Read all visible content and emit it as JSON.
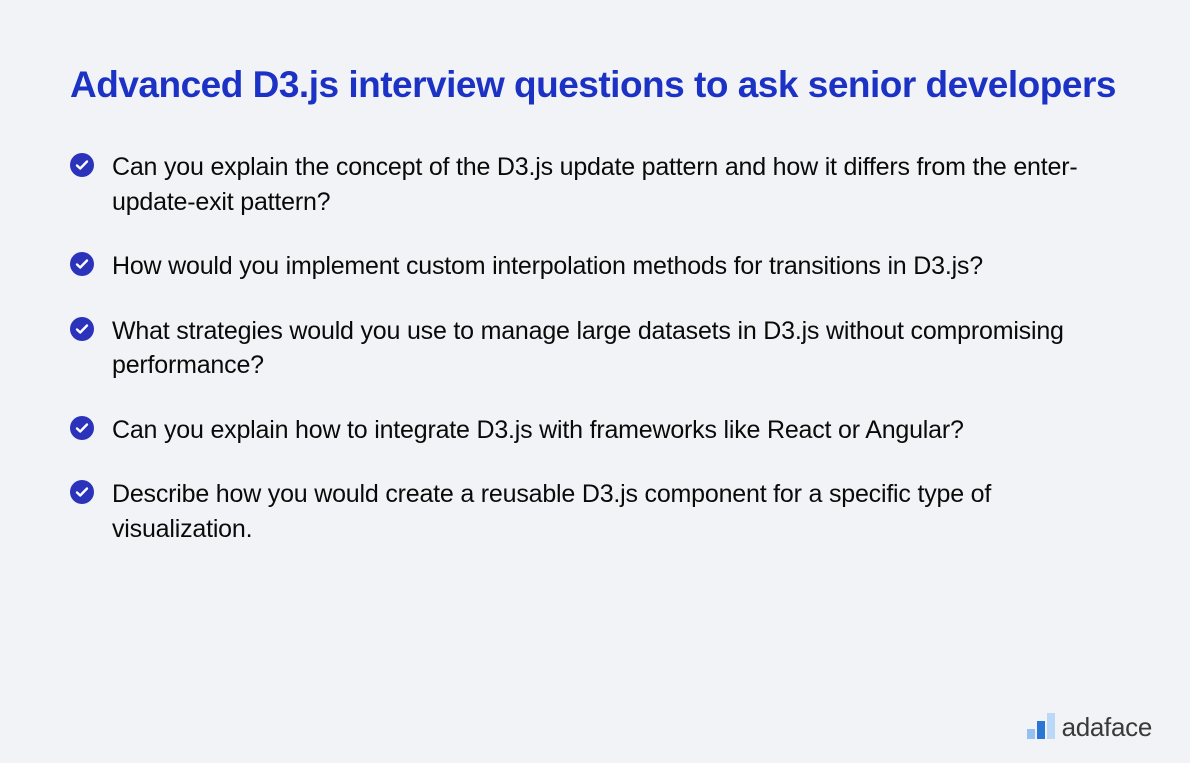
{
  "title": "Advanced D3.js interview questions to ask senior developers",
  "questions": [
    "Can you explain the concept of the D3.js update pattern and how it differs from the enter-update-exit pattern?",
    "How would you implement custom interpolation methods for transitions in D3.js?",
    "What strategies would you use to manage large datasets in D3.js without compromising performance?",
    "Can you explain how to integrate D3.js with frameworks like React or Angular?",
    "Describe how you would create a reusable D3.js component for a specific type of visualization."
  ],
  "brand": "adaface"
}
